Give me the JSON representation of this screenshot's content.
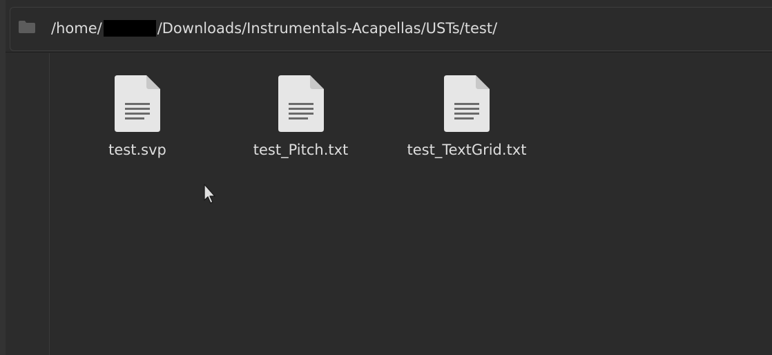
{
  "pathbar": {
    "folder_icon": "folder-icon",
    "path_prefix": "/home/",
    "path_redacted": true,
    "path_suffix": "/Downloads/Instrumentals-Acapellas/USTs/test/"
  },
  "files": [
    {
      "name": "test.svp",
      "icon": "text-file-icon"
    },
    {
      "name": "test_Pitch.txt",
      "icon": "text-file-icon"
    },
    {
      "name": "test_TextGrid.txt",
      "icon": "text-file-icon"
    }
  ],
  "colors": {
    "background": "#2b2b2b",
    "text": "#dedede",
    "icon_page": "#e8e8e8",
    "icon_lines": "#6a6a6a"
  }
}
